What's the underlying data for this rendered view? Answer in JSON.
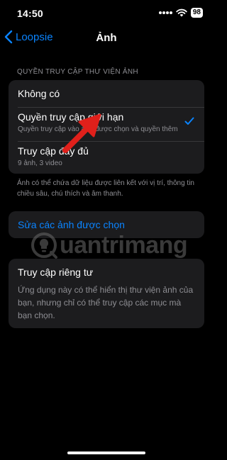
{
  "status_bar": {
    "time": "14:50",
    "battery": "98"
  },
  "nav": {
    "back_label": "Loopsie",
    "title": "Ảnh"
  },
  "photo_access": {
    "section_header": "QUYỀN TRUY CẬP THƯ VIỆN ẢNH",
    "options": [
      {
        "title": "Không có",
        "subtitle": "",
        "selected": false
      },
      {
        "title": "Quyền truy cập giới hạn",
        "subtitle": "Quyền truy cập vào ảnh được chọn và quyền thêm",
        "selected": true
      },
      {
        "title": "Truy cập đầy đủ",
        "subtitle": "9 ảnh, 3 video",
        "selected": false
      }
    ],
    "footnote": "Ảnh có thể chứa dữ liệu được liên kết với vị trí, thông tin chiều sâu, chú thích và âm thanh."
  },
  "edit_selection": {
    "label": "Sửa các ảnh được chọn"
  },
  "private_access": {
    "title": "Truy cập riêng tư",
    "description": "Ứng dụng này có thể hiển thị thư viện ảnh của bạn, nhưng chỉ có thể truy cập các mục mà bạn chọn."
  },
  "watermark": {
    "text": "uantrimang"
  },
  "colors": {
    "accent": "#0a84ff",
    "background": "#000000",
    "card": "#1c1c1e",
    "secondary_text": "#8e8e93",
    "annotation_arrow": "#e0201b"
  },
  "icons": {
    "back": "chevron-left-icon",
    "selected": "checkmark-icon",
    "wifi": "wifi-icon",
    "cellular": "signal-dots-icon"
  }
}
